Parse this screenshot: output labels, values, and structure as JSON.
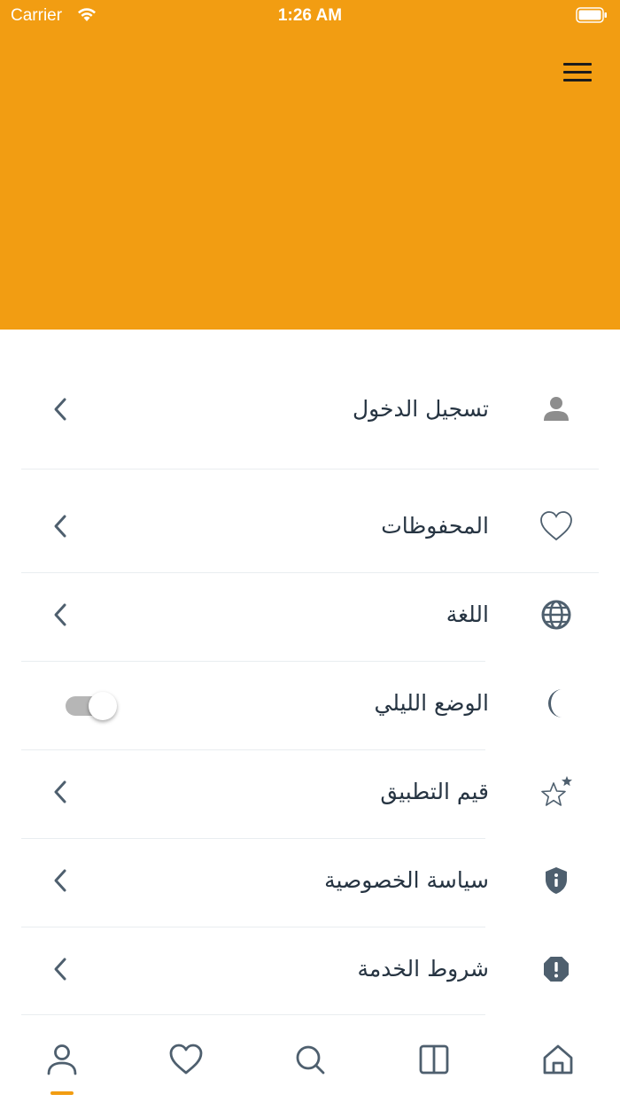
{
  "status_bar": {
    "carrier": "Carrier",
    "time": "1:26 AM"
  },
  "colors": {
    "header": "#f29d12",
    "accent": "#f29d12",
    "icon": "#4e5f6e",
    "text": "#263442"
  },
  "menu": {
    "items": [
      {
        "label": "تسجيل الدخول",
        "icon": "user-icon"
      },
      {
        "label": "المحفوظات",
        "icon": "heart-icon"
      },
      {
        "label": "اللغة",
        "icon": "globe-icon"
      },
      {
        "label": "الوضع الليلي",
        "icon": "moon-icon",
        "toggle_on": true
      },
      {
        "label": "قيم التطبيق",
        "icon": "star-icon"
      },
      {
        "label": "سياسة الخصوصية",
        "icon": "shield-info-icon"
      },
      {
        "label": "شروط الخدمة",
        "icon": "alert-icon"
      }
    ]
  },
  "tabbar": {
    "tabs": [
      "profile-icon",
      "heart-icon",
      "search-icon",
      "book-icon",
      "home-icon"
    ],
    "active_tab": "profile"
  }
}
